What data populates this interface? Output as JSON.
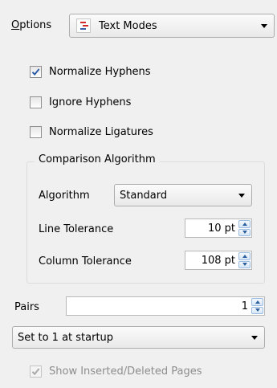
{
  "options": {
    "label": "Options",
    "mode_value": "Text Modes",
    "mode_icon": "text-modes-icon"
  },
  "checkboxes": [
    {
      "label": "Normalize Hyphens",
      "checked": true
    },
    {
      "label": "Ignore Hyphens",
      "checked": false
    },
    {
      "label": "Normalize Ligatures",
      "checked": false
    }
  ],
  "comparison": {
    "title": "Comparison Algorithm",
    "algorithm_label": "Algorithm",
    "algorithm_value": "Standard",
    "line_tolerance_label": "Line Tolerance",
    "line_tolerance_value": "10 pt",
    "column_tolerance_label": "Column Tolerance",
    "column_tolerance_value": "108 pt"
  },
  "pairs": {
    "label": "Pairs",
    "value": "1",
    "startup_value": "Set to 1 at startup"
  },
  "show_pages": {
    "label": "Show Inserted/Deleted Pages",
    "checked": true,
    "disabled": true
  },
  "colors": {
    "icon_red": "#d42a2a",
    "spinner_blue": "#2d5f9a",
    "disabled_text": "#8d8d8d"
  }
}
